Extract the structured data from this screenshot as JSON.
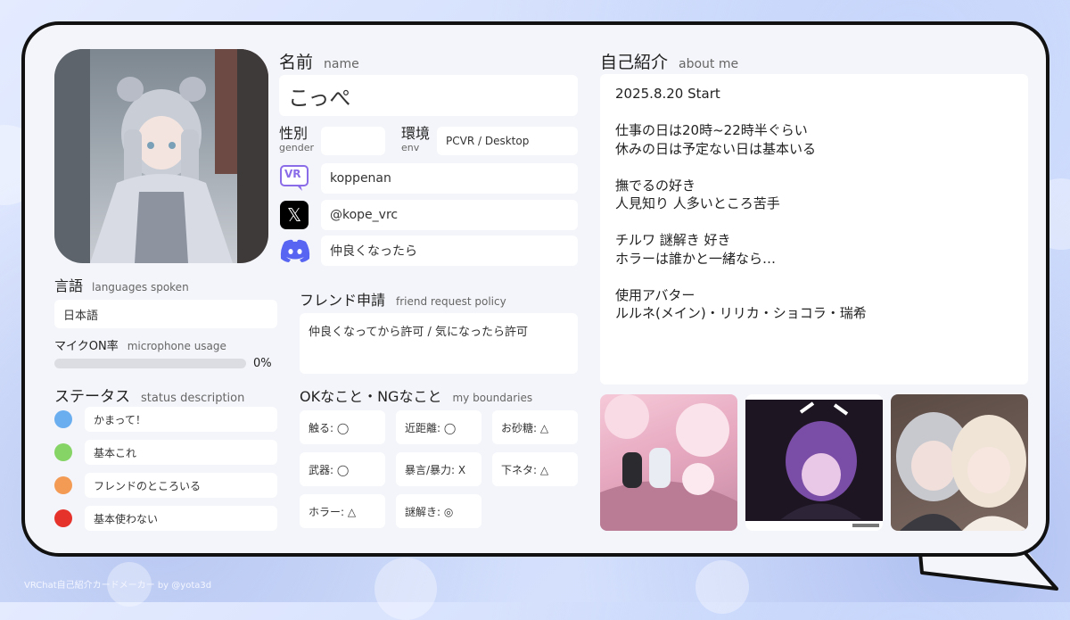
{
  "profile": {
    "name_label": "名前",
    "name_sub": "name",
    "name_value": "こっぺ",
    "gender_label": "性別",
    "gender_sub": "gender",
    "gender_value": "",
    "env_label": "環境",
    "env_sub": "env",
    "env_value": "PCVR / Desktop"
  },
  "social": {
    "vrchat_icon_text": "VR",
    "vrchat": "koppenan",
    "x_icon_text": "𝕏",
    "x": "@kope_vrc",
    "discord": "仲良くなったら"
  },
  "languages": {
    "label": "言語",
    "sub": "languages spoken",
    "value": "日本語"
  },
  "mic": {
    "label": "マイクON率",
    "sub": "microphone usage",
    "percent": 0,
    "percent_text": "0%"
  },
  "status": {
    "label": "ステータス",
    "sub": "status description",
    "items": [
      {
        "color": "#6aaef0",
        "text": "かまって！"
      },
      {
        "color": "#86d466",
        "text": "基本これ"
      },
      {
        "color": "#f39a54",
        "text": "フレンドのところいる"
      },
      {
        "color": "#e5322b",
        "text": "基本使わない"
      }
    ]
  },
  "friend": {
    "label": "フレンド申請",
    "sub": "friend request policy",
    "value": "仲良くなってから許可 / 気になったら許可"
  },
  "boundaries": {
    "label": "OKなこと・NGなこと",
    "sub": "my boundaries",
    "items": [
      "触る: ◯",
      "近距離: ◯",
      "お砂糖: △",
      "武器: ◯",
      "暴言/暴力: X",
      "下ネタ: △",
      "ホラー: △",
      "謎解き: ◎"
    ]
  },
  "about": {
    "label": "自己紹介",
    "sub": "about me",
    "lines": [
      "2025.8.20 Start",
      "",
      "仕事の日は20時~22時半ぐらい",
      "休みの日は予定ない日は基本いる",
      "",
      "撫でるの好き",
      "人見知り 人多いところ苦手",
      "",
      "チルワ 謎解き 好き",
      "ホラーは誰かと一緒なら…",
      "",
      "使用アバター",
      "ルルネ(メイン)・リリカ・ショコラ・瑞希"
    ]
  },
  "footer": {
    "credit": "VRChat自己紹介カードメーカー by @yota3d"
  },
  "colors": {
    "discord": "#5865f2",
    "vrchat": "#8a6be8"
  }
}
